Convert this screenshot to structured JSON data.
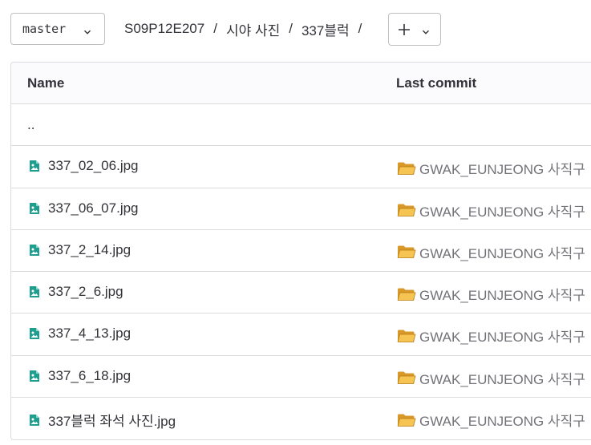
{
  "toolbar": {
    "branch": "master",
    "breadcrumb": [
      "S09P12E207",
      "시야 사진",
      "337블럭"
    ],
    "separator": "/"
  },
  "table": {
    "headers": {
      "name": "Name",
      "last_commit": "Last commit"
    },
    "parent_link": "..",
    "rows": [
      {
        "name": "337_02_06.jpg",
        "commit": "GWAK_EUNJEONG 사직구"
      },
      {
        "name": "337_06_07.jpg",
        "commit": "GWAK_EUNJEONG 사직구"
      },
      {
        "name": "337_2_14.jpg",
        "commit": "GWAK_EUNJEONG 사직구"
      },
      {
        "name": "337_2_6.jpg",
        "commit": "GWAK_EUNJEONG 사직구"
      },
      {
        "name": "337_4_13.jpg",
        "commit": "GWAK_EUNJEONG 사직구"
      },
      {
        "name": "337_6_18.jpg",
        "commit": "GWAK_EUNJEONG 사직구"
      },
      {
        "name": "337블럭 좌석 사진.jpg",
        "commit": "GWAK_EUNJEONG 사직구"
      }
    ]
  },
  "icons": {
    "file": "image-file-icon",
    "commit": "open-folder-icon",
    "branch_dropdown": "chevron-down-icon",
    "add": "plus-icon"
  },
  "colors": {
    "file_icon": "#1f9e8f",
    "folder": "#e8b23a",
    "border": "#dcdcde",
    "header_bg": "#fbfafd"
  }
}
